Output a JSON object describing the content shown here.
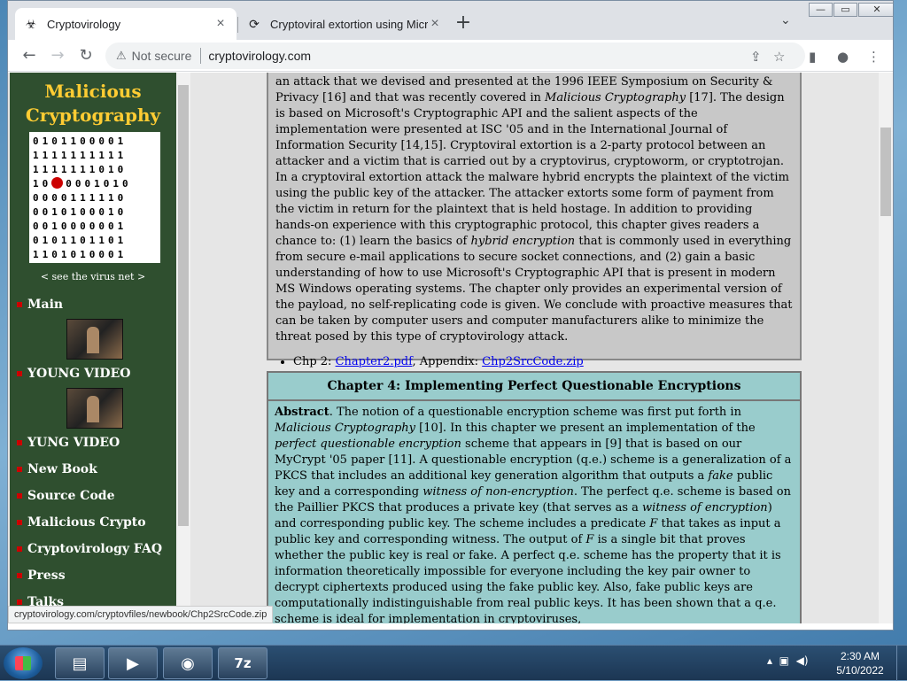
{
  "browser": {
    "tabs": [
      {
        "title": "Cryptovirology",
        "icon": "biohazard-icon",
        "active": true
      },
      {
        "title": "Cryptoviral extortion using Micro",
        "icon": "chrome-page-icon",
        "active": false
      }
    ],
    "new_tab_label": "+",
    "window_controls": {
      "minimize": "—",
      "restore": "▭",
      "close": "✕"
    },
    "security_label": "Not secure",
    "url": "cryptovirology.com",
    "status_url": "cryptovirology.com/cryptovfiles/newbook/Chp2SrcCode.zip"
  },
  "sidebar": {
    "title_line1": "Malicious",
    "title_line2": "Cryptography",
    "title_color": "#ffcc33",
    "bg_color": "#2f4f2f",
    "virus_grid": [
      "0101100001",
      "1111111111",
      "1111111010",
      "10",
      "0000111110",
      "0010100010",
      "0010000001",
      "0101101101",
      "1101010001"
    ],
    "virus_row4_rest": "0001010",
    "see_net": "< see the virus net >",
    "items": [
      {
        "label": "Main"
      },
      {
        "label": "YOUNG VIDEO"
      },
      {
        "label": "YUNG VIDEO"
      },
      {
        "label": "New Book"
      },
      {
        "label": "Source Code"
      },
      {
        "label": "Malicious Crypto"
      },
      {
        "label": "Cryptovirology FAQ"
      },
      {
        "label": "Press"
      },
      {
        "label": "Talks"
      }
    ]
  },
  "content": {
    "chapter2": {
      "p1": "an attack that we devised and presented at the 1996 IEEE Symposium on Security & Privacy [16] and that was recently covered in ",
      "p1_em": "Malicious Cryptography",
      "p2": " [17]. The design is based on Microsoft's Cryptographic API and the salient aspects of the implementation were presented at ISC '05 and in the International Journal of Information Security [14,15]. Cryptoviral extortion is a 2-party protocol between an attacker and a victim that is carried out by a cryptovirus, cryptoworm, or cryptotrojan. In a cryptoviral extortion attack the malware hybrid encrypts the plaintext of the victim using the public key of the attacker. The attacker extorts some form of payment from the victim in return for the plaintext that is held hostage. In addition to providing hands-on experience with this cryptographic protocol, this chapter gives readers a chance to: (1) learn the basics of ",
      "p2_em": "hybrid encryption",
      "p3": " that is commonly used in everything from secure e-mail applications to secure socket connections, and (2) gain a basic understanding of how to use Microsoft's Cryptographic API that is present in modern MS Windows operating systems. The chapter only provides an experimental version of the payload, no self-replicating code is given. We conclude with proactive measures that can be taken by computer users and computer manufacturers alike to minimize the threat posed by this type of cryptovirology attack.",
      "link_prefix": "Chp 2: ",
      "link1": "Chapter2.pdf",
      "link_mid": ", Appendix: ",
      "link2": "Chp2SrcCode.zip"
    },
    "chapter4": {
      "heading": "Chapter 4: Implementing Perfect Questionable Encryptions",
      "abstract_label": "Abstract",
      "t1": ". The notion of a questionable encryption scheme was first put forth in ",
      "e1": "Malicious Cryptography",
      "t2": " [10]. In this chapter we present an implementation of the ",
      "e2": "perfect questionable encryption",
      "t3": " scheme that appears in [9] that is based on our MyCrypt '05 paper [11]. A questionable encryption (q.e.) scheme is a generalization of a PKCS that includes an additional key generation algorithm that outputs a ",
      "e3": "fake",
      "t4": " public key and a corresponding ",
      "e4": "witness of non-encryption",
      "t5": ". The perfect q.e. scheme is based on the Paillier PKCS that produces a private key (that serves as a ",
      "e5": "witness of encryption",
      "t6": ") and corresponding public key. The scheme includes a predicate ",
      "e6": "F",
      "t7": " that takes as input a public key and corresponding witness. The output of ",
      "e7": "F",
      "t8": " is a single bit that proves whether the public key is real or fake. A perfect q.e. scheme has the property that it is information theoretically impossible for everyone including the key pair owner to decrypt ciphertexts produced using the fake public key. Also, fake public keys are computationally indistinguishable from real public keys. It has been shown that a q.e. scheme is ideal for implementation in cryptoviruses,"
    }
  },
  "taskbar": {
    "items": [
      "explorer-icon",
      "media-player-icon",
      "chrome-icon",
      "7zip-icon"
    ],
    "zip_label": "7z",
    "time": "2:30 AM",
    "date": "5/10/2022"
  }
}
